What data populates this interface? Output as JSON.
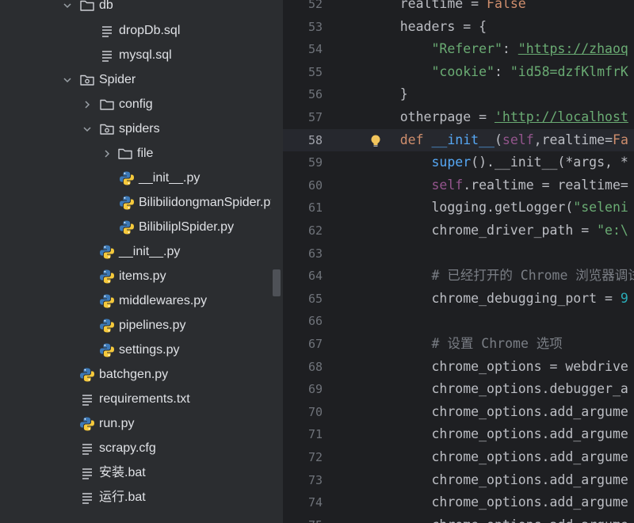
{
  "tree": {
    "items": [
      {
        "name": "db",
        "type": "folder",
        "expanded": true
      },
      {
        "name": "dropDb.sql",
        "type": "text"
      },
      {
        "name": "mysql.sql",
        "type": "text"
      },
      {
        "name": "Spider",
        "type": "package",
        "expanded": true
      },
      {
        "name": "config",
        "type": "folder",
        "expanded": false
      },
      {
        "name": "spiders",
        "type": "package",
        "expanded": true
      },
      {
        "name": "file",
        "type": "folder",
        "expanded": false
      },
      {
        "name": "__init__.py",
        "type": "python"
      },
      {
        "name": "BilibilidongmanSpider.py",
        "type": "python"
      },
      {
        "name": "BilibiliplSpider.py",
        "type": "python"
      },
      {
        "name": "__init__.py",
        "type": "python"
      },
      {
        "name": "items.py",
        "type": "python"
      },
      {
        "name": "middlewares.py",
        "type": "python"
      },
      {
        "name": "pipelines.py",
        "type": "python"
      },
      {
        "name": "settings.py",
        "type": "python"
      },
      {
        "name": "batchgen.py",
        "type": "python"
      },
      {
        "name": "requirements.txt",
        "type": "text"
      },
      {
        "name": "run.py",
        "type": "python"
      },
      {
        "name": "scrapy.cfg",
        "type": "text"
      },
      {
        "name": "安装.bat",
        "type": "text"
      },
      {
        "name": "运行.bat",
        "type": "text"
      }
    ]
  },
  "editor": {
    "current_line": "58",
    "lines": [
      {
        "n": "52",
        "segs": [
          {
            "t": "    realtime = ",
            "c": ""
          },
          {
            "t": "False",
            "c": "kw"
          }
        ]
      },
      {
        "n": "53",
        "segs": [
          {
            "t": "    headers = {",
            "c": ""
          }
        ]
      },
      {
        "n": "54",
        "segs": [
          {
            "t": "        ",
            "c": ""
          },
          {
            "t": "\"Referer\"",
            "c": "str"
          },
          {
            "t": ": ",
            "c": ""
          },
          {
            "t": "\"https://zhaoq",
            "c": "url"
          }
        ]
      },
      {
        "n": "55",
        "segs": [
          {
            "t": "        ",
            "c": ""
          },
          {
            "t": "\"cookie\"",
            "c": "str"
          },
          {
            "t": ": ",
            "c": ""
          },
          {
            "t": "\"id58=dzfKlmfrK",
            "c": "str"
          }
        ]
      },
      {
        "n": "56",
        "segs": [
          {
            "t": "    }",
            "c": ""
          }
        ]
      },
      {
        "n": "57",
        "segs": [
          {
            "t": "    otherpage = ",
            "c": ""
          },
          {
            "t": "'http://localhost",
            "c": "url"
          }
        ]
      },
      {
        "n": "58",
        "segs": [
          {
            "t": "    ",
            "c": ""
          },
          {
            "t": "def ",
            "c": "kw"
          },
          {
            "t": "__init__",
            "c": "fn"
          },
          {
            "t": "(",
            "c": ""
          },
          {
            "t": "self",
            "c": "self"
          },
          {
            "t": ",realtime=",
            "c": ""
          },
          {
            "t": "Fa",
            "c": "kw"
          }
        ]
      },
      {
        "n": "59",
        "segs": [
          {
            "t": "        ",
            "c": ""
          },
          {
            "t": "super",
            "c": "fn"
          },
          {
            "t": "().__init__(*args, *",
            "c": ""
          }
        ]
      },
      {
        "n": "60",
        "segs": [
          {
            "t": "        ",
            "c": ""
          },
          {
            "t": "self",
            "c": "self"
          },
          {
            "t": ".realtime = realtime=",
            "c": ""
          }
        ]
      },
      {
        "n": "61",
        "segs": [
          {
            "t": "        logging.getLogger(",
            "c": ""
          },
          {
            "t": "\"seleni",
            "c": "str"
          }
        ]
      },
      {
        "n": "62",
        "segs": [
          {
            "t": "        chrome_driver_path = ",
            "c": ""
          },
          {
            "t": "\"e:\\",
            "c": "str"
          }
        ]
      },
      {
        "n": "63",
        "segs": []
      },
      {
        "n": "64",
        "segs": [
          {
            "t": "        # 已经打开的 Chrome 浏览器调试",
            "c": "cmt"
          }
        ]
      },
      {
        "n": "65",
        "segs": [
          {
            "t": "        chrome_debugging_port = ",
            "c": ""
          },
          {
            "t": "9",
            "c": "num"
          }
        ]
      },
      {
        "n": "66",
        "segs": []
      },
      {
        "n": "67",
        "segs": [
          {
            "t": "        # 设置 Chrome 选项",
            "c": "cmt"
          }
        ]
      },
      {
        "n": "68",
        "segs": [
          {
            "t": "        chrome_options = webdrive",
            "c": ""
          }
        ]
      },
      {
        "n": "69",
        "segs": [
          {
            "t": "        chrome_options.debugger_a",
            "c": ""
          }
        ]
      },
      {
        "n": "70",
        "segs": [
          {
            "t": "        chrome_options.add_argume",
            "c": ""
          }
        ]
      },
      {
        "n": "71",
        "segs": [
          {
            "t": "        chrome_options.add_argume",
            "c": ""
          }
        ]
      },
      {
        "n": "72",
        "segs": [
          {
            "t": "        chrome_options.add_argume",
            "c": ""
          }
        ]
      },
      {
        "n": "73",
        "segs": [
          {
            "t": "        chrome_options.add_argume",
            "c": ""
          }
        ]
      },
      {
        "n": "74",
        "segs": [
          {
            "t": "        chrome_options.add_argume",
            "c": ""
          }
        ]
      },
      {
        "n": "75",
        "segs": [
          {
            "t": "        chrome_options.add_argume",
            "c": ""
          }
        ]
      }
    ]
  }
}
